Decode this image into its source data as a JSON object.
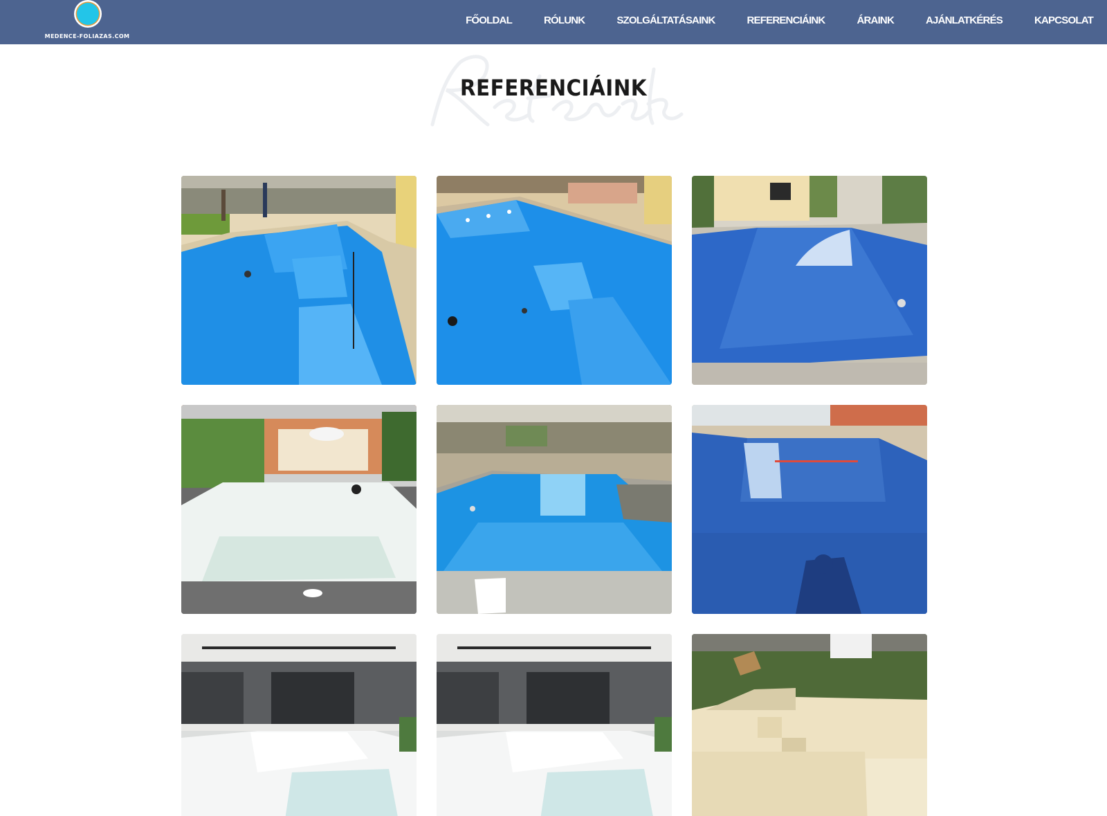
{
  "site": {
    "logo_text": "MEDENCE-FOLIAZAS.COM",
    "header_color": "#4d6490",
    "logo_accent": "#23c5e8"
  },
  "nav": {
    "items": [
      {
        "label": "FŐOLDAL"
      },
      {
        "label": "RÓLUNK"
      },
      {
        "label": "SZOLGÁLTATÁSAINK"
      },
      {
        "label": "REFERENCIÁINK"
      },
      {
        "label": "ÁRAINK"
      },
      {
        "label": "AJÁNLATKÉRÉS"
      },
      {
        "label": "KAPCSOLAT"
      }
    ]
  },
  "page": {
    "title": "REFERENCIÁINK"
  },
  "gallery": {
    "photos": [
      {
        "subject": "blue foil pool under construction",
        "liner": "#1e8fe6"
      },
      {
        "subject": "blue foil pool with steps",
        "liner": "#1e90ea"
      },
      {
        "subject": "mosaic blue pool with curved steps",
        "liner": "#2d68c8"
      },
      {
        "subject": "white pool being lined",
        "liner": "#e9eef0"
      },
      {
        "subject": "blue pool with side bench",
        "liner": "#1d93e3"
      },
      {
        "subject": "mosaic blue pool with steps",
        "liner": "#2d62bb"
      },
      {
        "subject": "white pool near modern house",
        "liner": "#eef1f2"
      },
      {
        "subject": "white pool near modern house",
        "liner": "#eef1f2"
      },
      {
        "subject": "sand colored pool with steps",
        "liner": "#efe3c3"
      }
    ]
  }
}
